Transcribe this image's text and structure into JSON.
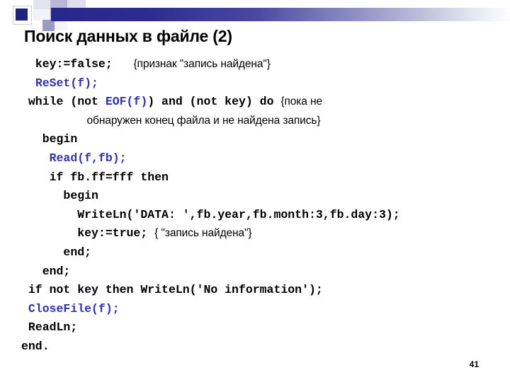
{
  "slide": {
    "title": "Поиск данных в файле (2)",
    "page_number": "41",
    "accent_color": "#27278c",
    "code_keyword_color": "#000000",
    "code_identifier_color": "#3232a8"
  },
  "decoration": {
    "name": "header-band",
    "gradient_from": "#27278c",
    "gradient_to": "#fdfdff"
  },
  "code": {
    "lines": [
      {
        "indent": "  ",
        "parts": [
          {
            "style": "kw",
            "text": "key:=false;"
          },
          {
            "style": "kw",
            "text": "   "
          },
          {
            "style": "comment",
            "text": "{признак \"запись найдена\"}"
          }
        ]
      },
      {
        "indent": "  ",
        "parts": [
          {
            "style": "blue",
            "text": "ReSet(f);"
          }
        ]
      },
      {
        "indent": " ",
        "parts": [
          {
            "style": "kw",
            "text": "while (not "
          },
          {
            "style": "blue",
            "text": "EOF(f)"
          },
          {
            "style": "kw",
            "text": ") and (not key) do "
          },
          {
            "style": "comment",
            "text": "{пока не"
          }
        ]
      },
      {
        "indent": "",
        "parts": [
          {
            "style": "comment",
            "text": "                      обнаружен конец файла и не найдена запись}"
          }
        ]
      },
      {
        "indent": "   ",
        "parts": [
          {
            "style": "kw",
            "text": "begin"
          }
        ]
      },
      {
        "indent": "    ",
        "parts": [
          {
            "style": "blue",
            "text": "Read(f,fb);"
          }
        ]
      },
      {
        "indent": "    ",
        "parts": [
          {
            "style": "kw",
            "text": "if fb.ff=fff then"
          }
        ]
      },
      {
        "indent": "      ",
        "parts": [
          {
            "style": "kw",
            "text": "begin"
          }
        ]
      },
      {
        "indent": "        ",
        "parts": [
          {
            "style": "kw",
            "text": "WriteLn('DATA: ',fb.year,fb.month:3,fb.day:3);"
          }
        ]
      },
      {
        "indent": "        ",
        "parts": [
          {
            "style": "kw",
            "text": "key:=true; "
          },
          {
            "style": "comment",
            "text": "{ \"запись найдена\"}"
          }
        ]
      },
      {
        "indent": "      ",
        "parts": [
          {
            "style": "kw",
            "text": "end;"
          }
        ]
      },
      {
        "indent": "   ",
        "parts": [
          {
            "style": "kw",
            "text": "end;"
          }
        ]
      },
      {
        "indent": " ",
        "parts": [
          {
            "style": "kw",
            "text": "if not key then WriteLn('No information');"
          }
        ]
      },
      {
        "indent": " ",
        "parts": [
          {
            "style": "blue",
            "text": "CloseFile(f);"
          }
        ]
      },
      {
        "indent": " ",
        "parts": [
          {
            "style": "kw",
            "text": "ReadLn;"
          }
        ]
      },
      {
        "indent": "",
        "parts": [
          {
            "style": "kw",
            "text": "end."
          }
        ]
      }
    ]
  }
}
